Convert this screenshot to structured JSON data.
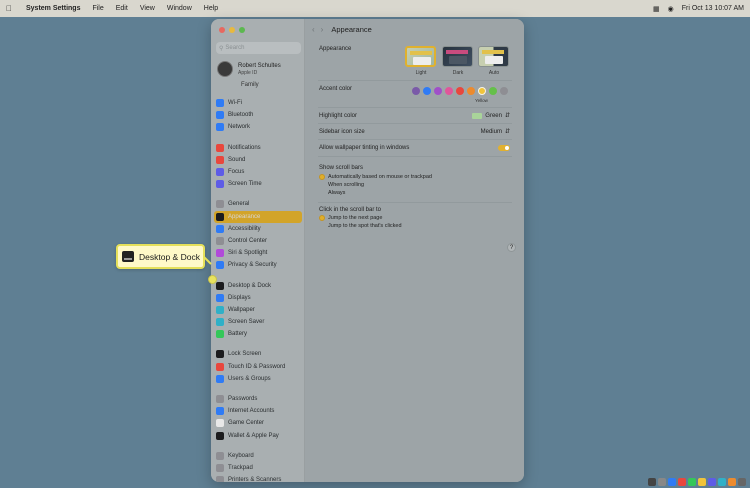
{
  "menubar": {
    "app_name": "System Settings",
    "items": [
      "File",
      "Edit",
      "View",
      "Window",
      "Help"
    ],
    "datetime": "Fri Oct 13  10:07 AM"
  },
  "sidebar": {
    "search_placeholder": "Search",
    "profile": {
      "name": "Robert Schultes",
      "sub": "Apple ID"
    },
    "family_label": "Family",
    "groups": [
      [
        {
          "label": "Wi-Fi",
          "color": "#2f7bf5"
        },
        {
          "label": "Bluetooth",
          "color": "#2f7bf5"
        },
        {
          "label": "Network",
          "color": "#2f7bf5"
        }
      ],
      [
        {
          "label": "Notifications",
          "color": "#e8473d"
        },
        {
          "label": "Sound",
          "color": "#e8473d"
        },
        {
          "label": "Focus",
          "color": "#5e5ce6"
        },
        {
          "label": "Screen Time",
          "color": "#5e5ce6"
        }
      ],
      [
        {
          "label": "General",
          "color": "#8e8e93"
        },
        {
          "label": "Appearance",
          "color": "#1c1c1e",
          "active": true
        },
        {
          "label": "Accessibility",
          "color": "#2f7bf5"
        },
        {
          "label": "Control Center",
          "color": "#8e8e93"
        },
        {
          "label": "Siri & Spotlight",
          "color": "#b14ad9"
        },
        {
          "label": "Privacy & Security",
          "color": "#2f7bf5"
        }
      ],
      [
        {
          "label": "Desktop & Dock",
          "color": "#1c1c1e"
        },
        {
          "label": "Displays",
          "color": "#2f7bf5"
        },
        {
          "label": "Wallpaper",
          "color": "#30b0c7"
        },
        {
          "label": "Screen Saver",
          "color": "#30b0c7"
        },
        {
          "label": "Battery",
          "color": "#34c759"
        }
      ],
      [
        {
          "label": "Lock Screen",
          "color": "#1c1c1e"
        },
        {
          "label": "Touch ID & Password",
          "color": "#e8473d"
        },
        {
          "label": "Users & Groups",
          "color": "#2f7bf5"
        }
      ],
      [
        {
          "label": "Passwords",
          "color": "#8e8e93"
        },
        {
          "label": "Internet Accounts",
          "color": "#2f7bf5"
        },
        {
          "label": "Game Center",
          "color": "#e8e8e8"
        },
        {
          "label": "Wallet & Apple Pay",
          "color": "#1c1c1e"
        }
      ],
      [
        {
          "label": "Keyboard",
          "color": "#8e8e93"
        },
        {
          "label": "Trackpad",
          "color": "#8e8e93"
        },
        {
          "label": "Printers & Scanners",
          "color": "#8e8e93"
        }
      ]
    ]
  },
  "content": {
    "title": "Appearance",
    "appearance_label": "Appearance",
    "modes": [
      "Light",
      "Dark",
      "Auto"
    ],
    "accent_label": "Accent color",
    "accent_colors": [
      "#7a5aa8",
      "#2f7bf5",
      "#a050c8",
      "#e0569a",
      "#e8473d",
      "#ec8b2e",
      "#f0c43a",
      "#65c04a",
      "#8e8e93"
    ],
    "accent_selected_name": "Yellow",
    "highlight_label": "Highlight color",
    "highlight_value": "Green",
    "sidebar_icon_label": "Sidebar icon size",
    "sidebar_icon_value": "Medium",
    "wallpaper_tint_label": "Allow wallpaper tinting in windows",
    "scroll_bars_label": "Show scroll bars",
    "scroll_options": [
      "Automatically based on mouse or trackpad",
      "When scrolling",
      "Always"
    ],
    "click_label": "Click in the scroll bar to",
    "click_options": [
      "Jump to the next page",
      "Jump to the spot that's clicked"
    ],
    "help": "?"
  },
  "callout": {
    "label": "Desktop & Dock"
  }
}
